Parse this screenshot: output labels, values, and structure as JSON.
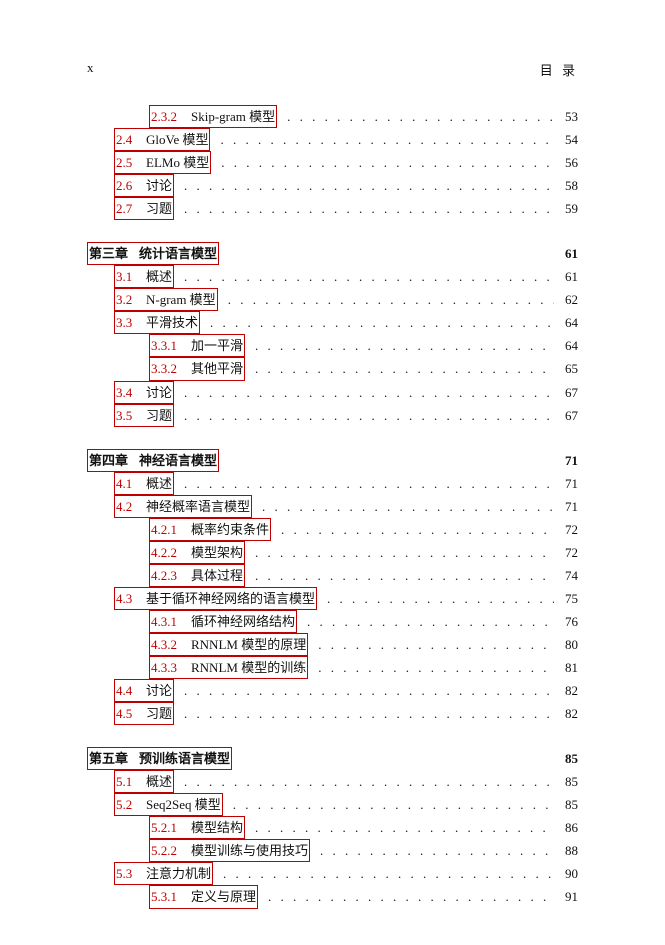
{
  "header": {
    "left": "x",
    "right": "目 录"
  },
  "entries": [
    {
      "type": "subsub",
      "num": "2.3.2",
      "title": "Skip-gram 模型",
      "page": "53"
    },
    {
      "type": "sub",
      "num": "2.4",
      "title": "GloVe 模型",
      "page": "54"
    },
    {
      "type": "sub",
      "num": "2.5",
      "title": "ELMo 模型",
      "page": "56"
    },
    {
      "type": "sub",
      "num": "2.6",
      "title": "讨论",
      "page": "58"
    },
    {
      "type": "sub",
      "num": "2.7",
      "title": "习题",
      "page": "59"
    },
    {
      "type": "chap",
      "num": "第三章",
      "title": "统计语言模型",
      "page": "61"
    },
    {
      "type": "sub",
      "num": "3.1",
      "title": "概述",
      "page": "61"
    },
    {
      "type": "sub",
      "num": "3.2",
      "title": "N-gram 模型",
      "page": "62"
    },
    {
      "type": "sub",
      "num": "3.3",
      "title": "平滑技术",
      "page": "64"
    },
    {
      "type": "subsub",
      "num": "3.3.1",
      "title": "加一平滑",
      "page": "64"
    },
    {
      "type": "subsub",
      "num": "3.3.2",
      "title": "其他平滑",
      "page": "65"
    },
    {
      "type": "sub",
      "num": "3.4",
      "title": "讨论",
      "page": "67"
    },
    {
      "type": "sub",
      "num": "3.5",
      "title": "习题",
      "page": "67"
    },
    {
      "type": "chap",
      "num": "第四章",
      "title": "神经语言模型",
      "page": "71"
    },
    {
      "type": "sub",
      "num": "4.1",
      "title": "概述",
      "page": "71"
    },
    {
      "type": "sub",
      "num": "4.2",
      "title": "神经概率语言模型",
      "page": "71"
    },
    {
      "type": "subsub",
      "num": "4.2.1",
      "title": "概率约束条件",
      "page": "72"
    },
    {
      "type": "subsub",
      "num": "4.2.2",
      "title": "模型架构",
      "page": "72"
    },
    {
      "type": "subsub",
      "num": "4.2.3",
      "title": "具体过程",
      "page": "74"
    },
    {
      "type": "sub",
      "num": "4.3",
      "title": "基于循环神经网络的语言模型",
      "page": "75"
    },
    {
      "type": "subsub",
      "num": "4.3.1",
      "title": "循环神经网络结构",
      "page": "76"
    },
    {
      "type": "subsub",
      "num": "4.3.2",
      "title": "RNNLM 模型的原理",
      "page": "80"
    },
    {
      "type": "subsub",
      "num": "4.3.3",
      "title": "RNNLM 模型的训练",
      "page": "81"
    },
    {
      "type": "sub",
      "num": "4.4",
      "title": "讨论",
      "page": "82"
    },
    {
      "type": "sub",
      "num": "4.5",
      "title": "习题",
      "page": "82"
    },
    {
      "type": "chap",
      "num": "第五章",
      "title": "预训练语言模型",
      "page": "85"
    },
    {
      "type": "sub",
      "num": "5.1",
      "title": "概述",
      "page": "85"
    },
    {
      "type": "sub",
      "num": "5.2",
      "title": "Seq2Seq 模型",
      "page": "85"
    },
    {
      "type": "subsub",
      "num": "5.2.1",
      "title": "模型结构",
      "page": "86"
    },
    {
      "type": "subsub",
      "num": "5.2.2",
      "title": "模型训练与使用技巧",
      "page": "88"
    },
    {
      "type": "sub",
      "num": "5.3",
      "title": "注意力机制",
      "page": "90"
    },
    {
      "type": "subsub",
      "num": "5.3.1",
      "title": "定义与原理",
      "page": "91"
    }
  ]
}
